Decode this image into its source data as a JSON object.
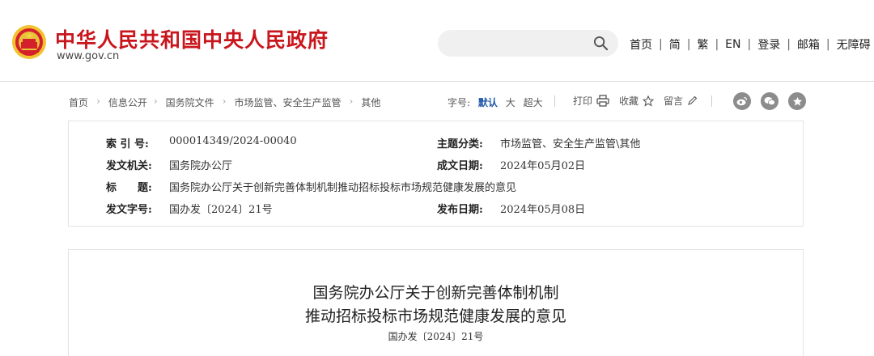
{
  "header": {
    "site_title": "中华人民共和国中央人民政府",
    "site_url": "www.gov.cn",
    "search": {
      "placeholder": ""
    },
    "nav": [
      "首页",
      "简",
      "繁",
      "EN",
      "登录",
      "邮箱",
      "无障碍"
    ],
    "nav_separator": "|"
  },
  "breadcrumb": {
    "items": [
      "首页",
      "信息公开",
      "国务院文件",
      "市场监管、安全生产监管",
      "其他"
    ],
    "separator": "›"
  },
  "font_size": {
    "label": "字号:",
    "options": [
      "默认",
      "大",
      "超大"
    ],
    "selected": "默认"
  },
  "tools": {
    "print": "打印",
    "favorite": "收藏",
    "comment": "留言"
  },
  "share": [
    "weibo-icon",
    "wechat-icon",
    "favorite-circle-icon"
  ],
  "info": {
    "index_label": "索 引 号:",
    "index_value": "000014349/2024-00040",
    "category_label": "主题分类:",
    "category_value": "市场监管、安全生产监管\\其他",
    "issuer_label": "发文机关:",
    "issuer_value": "国务院办公厅",
    "created_label": "成文日期:",
    "created_value": "2024年05月02日",
    "title_label": "标　　题:",
    "title_value": "国务院办公厅关于创新完善体制机制推动招标投标市场规范健康发展的意见",
    "docno_label": "发文字号:",
    "docno_value": "国办发〔2024〕21号",
    "published_label": "发布日期:",
    "published_value": "2024年05月08日"
  },
  "article": {
    "title_line1": "国务院办公厅关于创新完善体制机制",
    "title_line2": "推动招标投标市场规范健康发展的意见",
    "doc_number": "国办发〔2024〕21号"
  },
  "colors": {
    "brand_red": "#c8161d",
    "link_blue": "#1d58a8",
    "share_gray": "#8c8c8c"
  }
}
